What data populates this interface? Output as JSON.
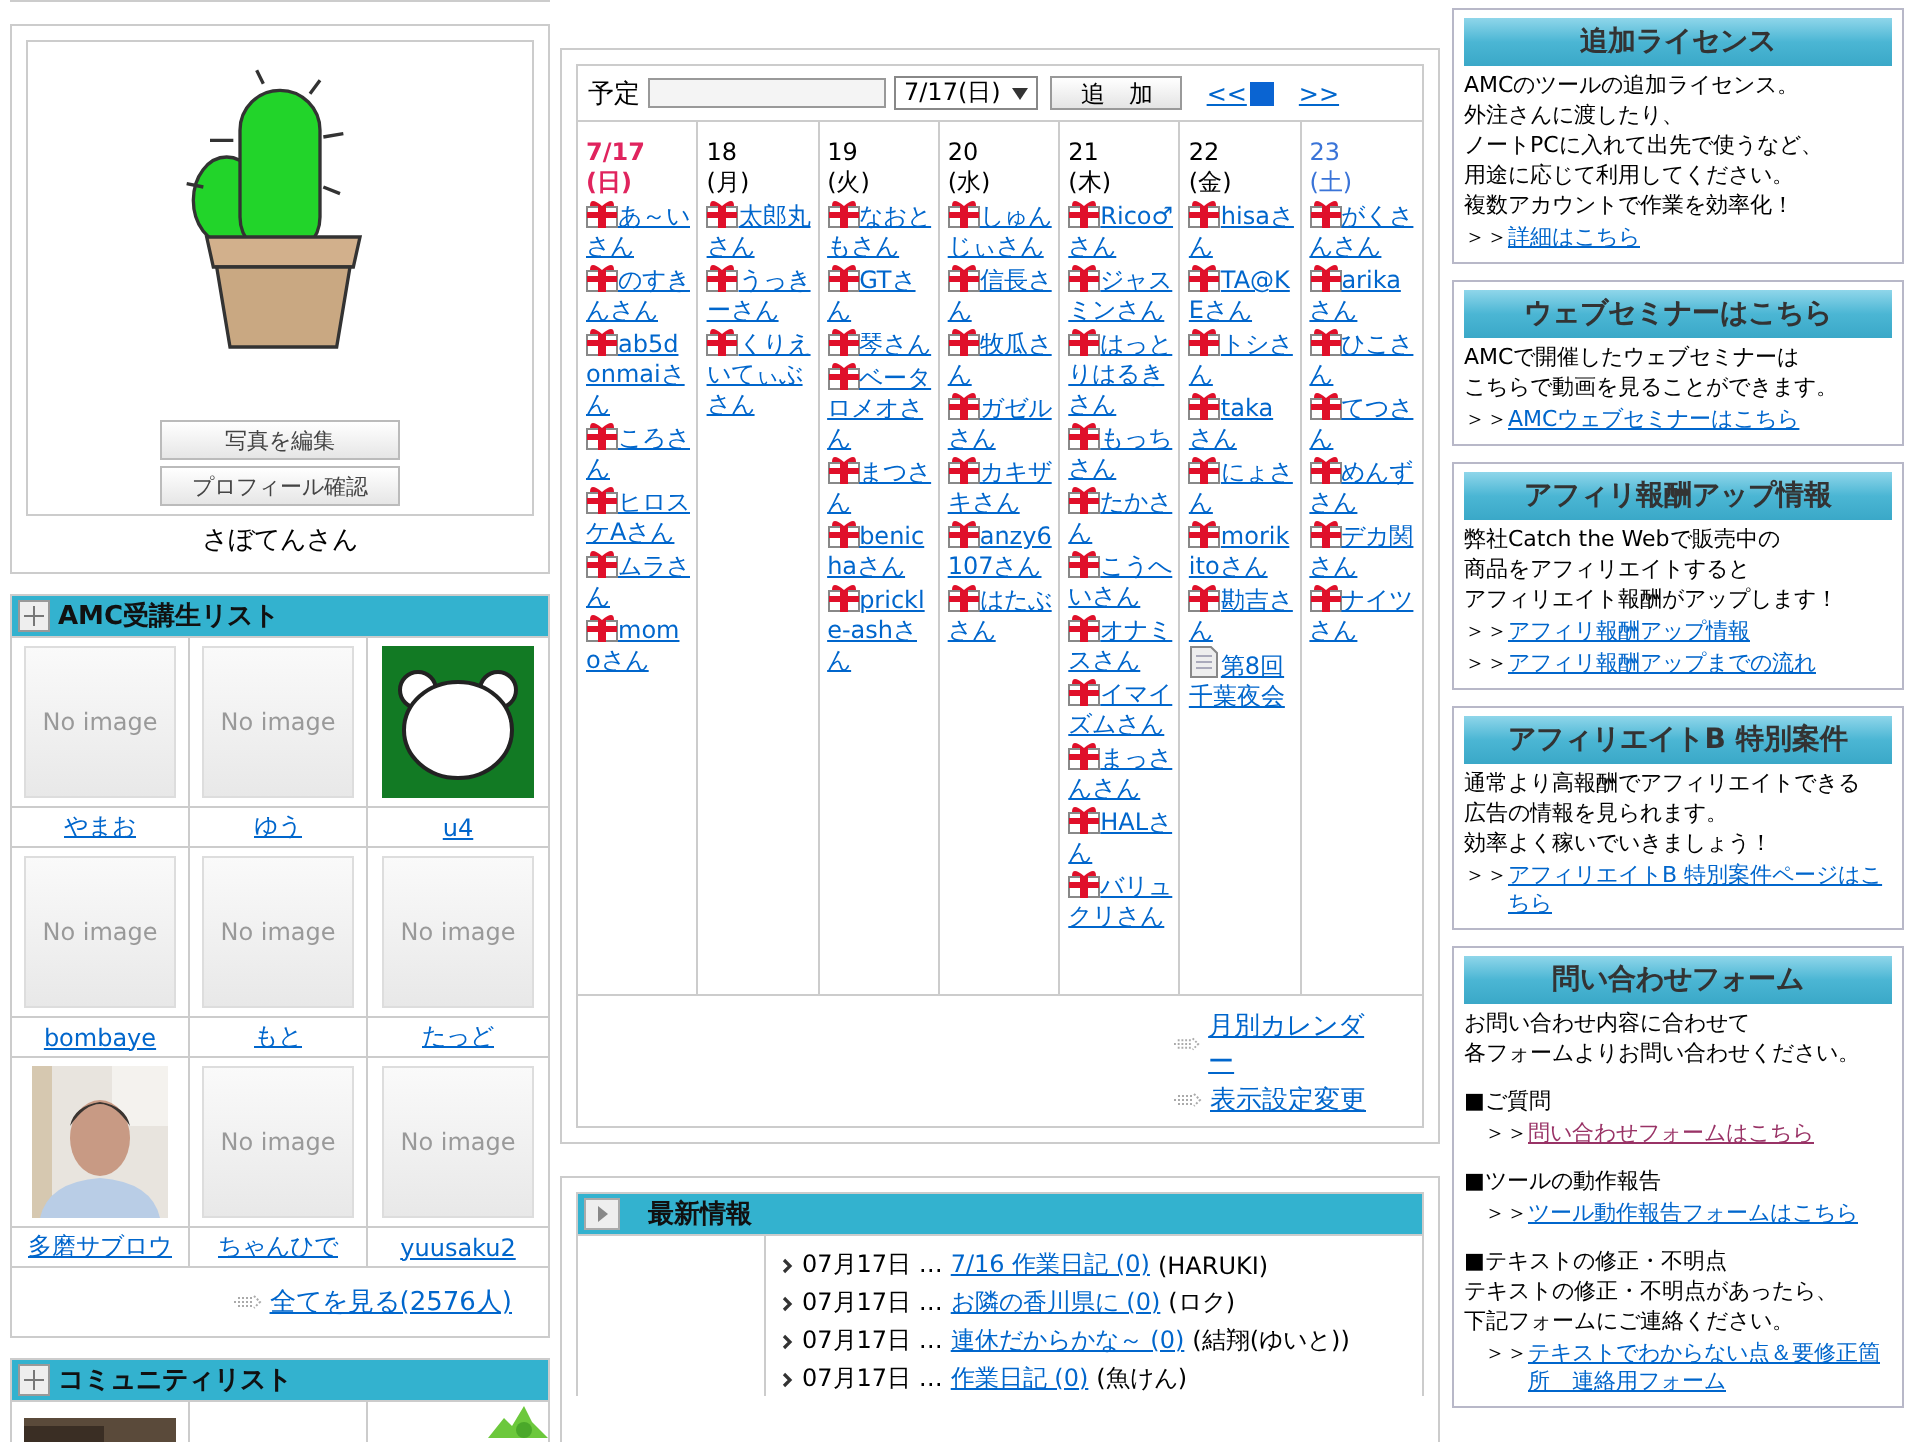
{
  "profile": {
    "buttons": [
      "写真を編集",
      "プロフィール確認"
    ],
    "name": "さぼてんさん"
  },
  "members": {
    "title": "AMC受講生リスト",
    "items": [
      {
        "name": "やまお",
        "kind": "none",
        "image_text": "No image"
      },
      {
        "name": "ゆう",
        "kind": "none",
        "image_text": "No image"
      },
      {
        "name": "u4",
        "kind": "bear"
      },
      {
        "name": "bombaye",
        "kind": "none",
        "image_text": "No image"
      },
      {
        "name": "もと",
        "kind": "none",
        "image_text": "No image"
      },
      {
        "name": "たっど",
        "kind": "none",
        "image_text": "No image"
      },
      {
        "name": "多磨サブロウ"
      },
      {
        "name": "ちゃんひで",
        "kind": "none",
        "image_text": "No image"
      },
      {
        "name": "yuusaku2",
        "kind": "none",
        "image_text": "No image"
      }
    ],
    "more": "全てを見る(2576人)"
  },
  "community": {
    "title": "コミュニティリスト"
  },
  "schedule": {
    "label": "予定",
    "date_select": "7/17(日)",
    "add_button": "追　加",
    "prev": "<<",
    "next": ">>",
    "days": [
      {
        "date": "7/17",
        "weekday": "(日)",
        "kind": "sunday",
        "today": true,
        "entries": [
          {
            "kind": "birthday",
            "text": "あ～いさん"
          },
          {
            "kind": "birthday",
            "text": "のすきんさん"
          },
          {
            "kind": "birthday",
            "text": "ab5donmaiさん"
          },
          {
            "kind": "birthday",
            "text": "ころさん"
          },
          {
            "kind": "birthday",
            "text": "ヒロスケAさん"
          },
          {
            "kind": "birthday",
            "text": "ムラさん"
          },
          {
            "kind": "birthday",
            "text": "momoさん"
          }
        ]
      },
      {
        "date": "18",
        "weekday": "(月)",
        "kind": "weekday",
        "today": false,
        "entries": [
          {
            "kind": "birthday",
            "text": "太郎丸さん"
          },
          {
            "kind": "birthday",
            "text": "うっきーさん"
          },
          {
            "kind": "birthday",
            "text": "くりえいてぃぶさん"
          }
        ]
      },
      {
        "date": "19",
        "weekday": "(火)",
        "kind": "weekday",
        "today": false,
        "entries": [
          {
            "kind": "birthday",
            "text": "なおともさん"
          },
          {
            "kind": "birthday",
            "text": "GTさん"
          },
          {
            "kind": "birthday",
            "text": "琴さん"
          },
          {
            "kind": "birthday",
            "text": "ベータロメオさん"
          },
          {
            "kind": "birthday",
            "text": "まつさん"
          },
          {
            "kind": "birthday",
            "text": "benichaさん"
          },
          {
            "kind": "birthday",
            "text": "prickle-ashさん"
          }
        ]
      },
      {
        "date": "20",
        "weekday": "(水)",
        "kind": "weekday",
        "today": false,
        "entries": [
          {
            "kind": "birthday",
            "text": "しゅんじぃさん"
          },
          {
            "kind": "birthday",
            "text": "信長さん"
          },
          {
            "kind": "birthday",
            "text": "牧瓜さん"
          },
          {
            "kind": "birthday",
            "text": "ガゼルさん"
          },
          {
            "kind": "birthday",
            "text": "カキザキさん"
          },
          {
            "kind": "birthday",
            "text": "anzy6107さん"
          },
          {
            "kind": "birthday",
            "text": "はたぶさん"
          }
        ]
      },
      {
        "date": "21",
        "weekday": "(木)",
        "kind": "weekday",
        "today": false,
        "entries": [
          {
            "kind": "birthday",
            "text": "Rico♂さん"
          },
          {
            "kind": "birthday",
            "text": "ジャスミンさん"
          },
          {
            "kind": "birthday",
            "text": "はっとりはるきさん"
          },
          {
            "kind": "birthday",
            "text": "もっちさん"
          },
          {
            "kind": "birthday",
            "text": "たかさん"
          },
          {
            "kind": "birthday",
            "text": "こうへいさん"
          },
          {
            "kind": "birthday",
            "text": "オナミスさん"
          },
          {
            "kind": "birthday",
            "text": "イマイズムさん"
          },
          {
            "kind": "birthday",
            "text": "まっさんさん"
          },
          {
            "kind": "birthday",
            "text": "HALさん"
          },
          {
            "kind": "birthday",
            "text": "バリュクリさん"
          }
        ]
      },
      {
        "date": "22",
        "weekday": "(金)",
        "kind": "weekday",
        "today": false,
        "entries": [
          {
            "kind": "birthday",
            "text": "hisaさん"
          },
          {
            "kind": "birthday",
            "text": "TA@KEさん"
          },
          {
            "kind": "birthday",
            "text": "トシさん"
          },
          {
            "kind": "birthday",
            "text": "takaさん"
          },
          {
            "kind": "birthday",
            "text": "にょさん"
          },
          {
            "kind": "birthday",
            "text": "morikitoさん"
          },
          {
            "kind": "birthday",
            "text": "勘吉さん"
          },
          {
            "kind": "event",
            "text": "第8回千葉夜会"
          }
        ]
      },
      {
        "date": "23",
        "weekday": "(土)",
        "kind": "saturday",
        "today": false,
        "entries": [
          {
            "kind": "birthday",
            "text": "がくさんさん"
          },
          {
            "kind": "birthday",
            "text": "arikaさん"
          },
          {
            "kind": "birthday",
            "text": "ひこさん"
          },
          {
            "kind": "birthday",
            "text": "てつさん"
          },
          {
            "kind": "birthday",
            "text": "めんずさん"
          },
          {
            "kind": "birthday",
            "text": "デカ関さん"
          },
          {
            "kind": "birthday",
            "text": "ナイツさん"
          }
        ]
      }
    ],
    "links": [
      "月別カレンダー",
      "表示設定変更"
    ]
  },
  "news": {
    "title": "最新情報",
    "items": [
      {
        "date": "07月17日 …",
        "link": "7/16 作業日記 (0)",
        "author": "(HARUKI)"
      },
      {
        "date": "07月17日 …",
        "link": "お隣の香川県に (0)",
        "author": "(ロク)"
      },
      {
        "date": "07月17日 …",
        "link": "連休だからかな～ (0)",
        "author": "(結翔(ゆいと))"
      },
      {
        "date": "07月17日 …",
        "link": "作業日記 (0)",
        "author": "(魚けん)"
      }
    ]
  },
  "sidebar": [
    {
      "title": "追加ライセンス",
      "lines": [
        {
          "kind": "text",
          "text": "AMCのツールの追加ライセンス。"
        },
        {
          "kind": "text",
          "text": "外注さんに渡したり、"
        },
        {
          "kind": "text",
          "text": "ノートPCに入れて出先で使うなど、"
        },
        {
          "kind": "text",
          "text": "用途に応じて利用してください。"
        },
        {
          "kind": "text",
          "text": "複数アカウントで作業を効率化！"
        },
        {
          "kind": "link",
          "prefix": "＞＞",
          "text": "詳細はこちら",
          "visited": false
        }
      ]
    },
    {
      "title": "ウェブセミナーはこちら",
      "lines": [
        {
          "kind": "text",
          "text": "AMCで開催したウェブセミナーは"
        },
        {
          "kind": "text",
          "text": "こちらで動画を見ることができます。"
        },
        {
          "kind": "link",
          "prefix": "＞＞",
          "text": "AMCウェブセミナーはこちら",
          "visited": false
        }
      ]
    },
    {
      "title": "アフィリ報酬アップ情報",
      "lines": [
        {
          "kind": "text",
          "text": "弊社Catch the Webで販売中の"
        },
        {
          "kind": "text",
          "text": "商品をアフィリエイトすると"
        },
        {
          "kind": "text",
          "text": "アフィリエイト報酬がアップします！"
        },
        {
          "kind": "link",
          "prefix": "＞＞",
          "text": "アフィリ報酬アップ情報",
          "visited": false
        },
        {
          "kind": "link",
          "prefix": "＞＞",
          "text": "アフィリ報酬アップまでの流れ",
          "visited": false
        }
      ]
    },
    {
      "title": "アフィリエイトB 特別案件",
      "lines": [
        {
          "kind": "text",
          "text": "通常より高報酬でアフィリエイトできる"
        },
        {
          "kind": "text",
          "text": "広告の情報を見られます。"
        },
        {
          "kind": "text",
          "text": "効率よく稼いでいきましょう！"
        },
        {
          "kind": "link",
          "prefix": "＞＞",
          "text": "アフィリエイトB 特別案件ページはこちら",
          "visited": false
        }
      ]
    },
    {
      "title": "問い合わせフォーム",
      "lines": [
        {
          "kind": "text",
          "text": "お問い合わせ内容に合わせて"
        },
        {
          "kind": "text",
          "text": "各フォームよりお問い合わせください。"
        },
        {
          "kind": "heading",
          "text": "■ご質問"
        },
        {
          "kind": "indented-link",
          "prefix": "＞＞",
          "text": "問い合わせフォームはこちら",
          "visited": true
        },
        {
          "kind": "heading",
          "text": "■ツールの動作報告"
        },
        {
          "kind": "indented-link",
          "prefix": "＞＞",
          "text": "ツール動作報告フォームはこちら",
          "visited": false
        },
        {
          "kind": "heading",
          "text": "■テキストの修正・不明点"
        },
        {
          "kind": "text",
          "text": "テキストの修正・不明点があったら、"
        },
        {
          "kind": "text",
          "text": "下記フォームにご連絡ください。"
        },
        {
          "kind": "indented-link",
          "prefix": "＞＞",
          "text": "テキストでわからない点＆要修正箇所　連絡用フォーム",
          "visited": false
        }
      ]
    }
  ]
}
